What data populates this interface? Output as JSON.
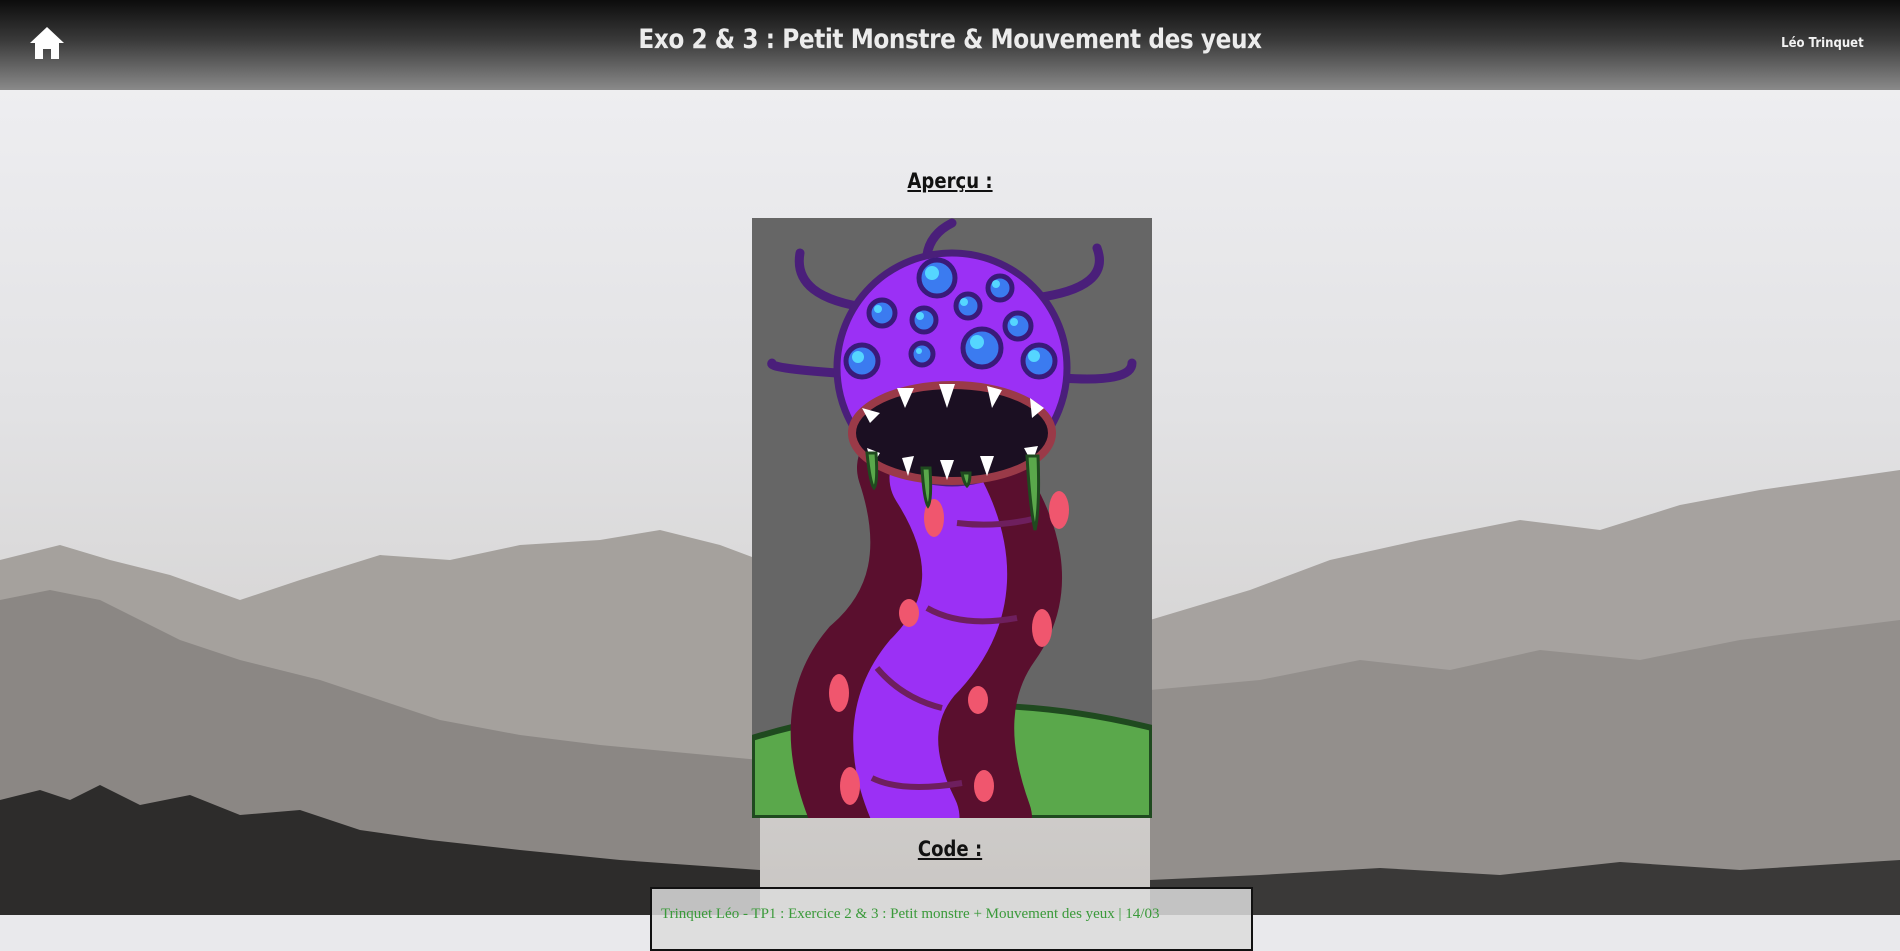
{
  "header": {
    "title": "Exo 2 & 3 : Petit Monstre & Mouvement des yeux",
    "author": "Léo Trinquet",
    "home_icon": "home-icon"
  },
  "main": {
    "preview_heading": "Aperçu :",
    "code_heading": "Code :",
    "code_first_line": "Trinquet Léo - TP1 : Exercice 2 & 3 : Petit monstre + Mouvement des yeux | 14/03"
  },
  "colors": {
    "header_top": "#0c0c0c",
    "header_bottom": "#8a8a8a",
    "canvas_bg": "#666666",
    "monster_purple": "#9b30f5",
    "tentacle_dark": "#5a0f2e",
    "ground_green": "#5aa84b",
    "code_comment": "#3a9a3a"
  }
}
